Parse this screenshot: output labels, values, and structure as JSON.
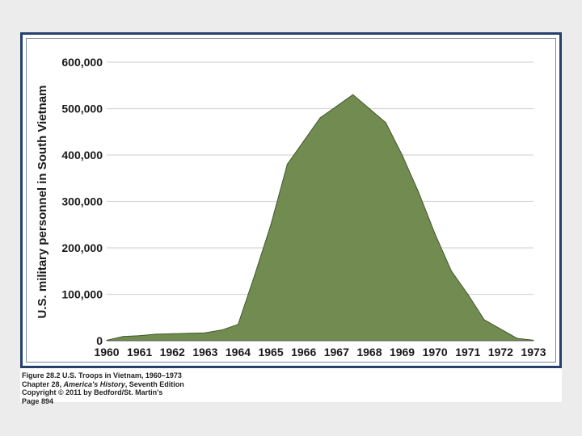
{
  "chart_data": {
    "type": "area",
    "title": "",
    "ylabel": "U.S. military personnel in South Vietnam",
    "xlabel": "",
    "ylim": [
      0,
      600000
    ],
    "yticks": [
      0,
      100000,
      200000,
      300000,
      400000,
      500000,
      600000
    ],
    "ytick_labels": [
      "0",
      "100,000",
      "200,000",
      "300,000",
      "400,000",
      "500,000",
      "600,000"
    ],
    "x": [
      1960,
      1960.5,
      1961,
      1961.5,
      1962,
      1962.5,
      1963,
      1963.5,
      1964,
      1964.5,
      1965,
      1965.5,
      1966,
      1966.5,
      1967,
      1967.5,
      1968,
      1968.5,
      1969,
      1969.5,
      1970,
      1970.5,
      1971,
      1971.5,
      1972,
      1972.5,
      1973
    ],
    "xtick_labels": [
      "1960",
      "1961",
      "1962",
      "1963",
      "1964",
      "1965",
      "1966",
      "1967",
      "1968",
      "1969",
      "1970",
      "1971",
      "1972",
      "1973"
    ],
    "series": [
      {
        "values": [
          900,
          9000,
          11000,
          14000,
          15000,
          16000,
          17000,
          23000,
          35000,
          140000,
          250000,
          380000,
          430000,
          480000,
          505000,
          530000,
          500000,
          470000,
          400000,
          320000,
          230000,
          150000,
          100000,
          45000,
          25000,
          5000,
          1000
        ]
      }
    ],
    "grid": true,
    "fill_color": "#728b51",
    "line_color": "#3f5a2e",
    "grid_color": "#d8d8d8"
  },
  "caption": {
    "line1": "Figure 28.2 U.S. Troops in Vietnam, 1960–1973",
    "line2_prefix": "Chapter 28, ",
    "line2_italic": "America's History",
    "line2_suffix": ", Seventh Edition",
    "line3": "Copyright © 2011 by Bedford/St. Martin's",
    "line4": "Page 894"
  }
}
